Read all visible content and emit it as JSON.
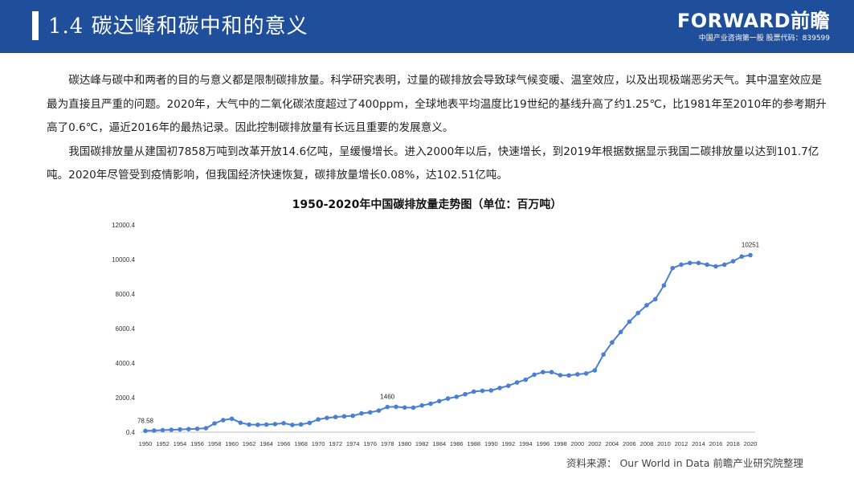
{
  "header": {
    "title": "1.4  碳达峰和碳中和的意义",
    "brand_logo": "FORWARD前瞻",
    "brand_sub": "中国产业咨询第一股  股票代码：839599"
  },
  "paragraphs": [
    "碳达峰与碳中和两者的目的与意义都是限制碳排放量。科学研究表明，过量的碳排放会导致球气候变暖、温室效应，以及出现极端恶劣天气。其中温室效应是最为直接且严重的问题。2020年，大气中的二氧化碳浓度超过了400ppm，全球地表平均温度比19世纪的基线升高了约1.25℃，比1981年至2010年的参考期升高了0.6℃，逼近2016年的最热记录。因此控制碳排放量有长远且重要的发展意义。",
    "我国碳排放量从建国初7858万吨到改革开放14.6亿吨，呈缓慢增长。进入2000年以后，快速增长，到2019年根据数据显示我国二碳排放量以达到101.7亿吨。2020年尽管受到疫情影响，但我国经济快速恢复，碳排放量增长0.08%，达102.51亿吨。"
  ],
  "chart_data": {
    "type": "line",
    "title": "1950-2020年中国碳排放量走势图（单位：百万吨）",
    "x": [
      1950,
      1951,
      1952,
      1953,
      1954,
      1955,
      1956,
      1957,
      1958,
      1959,
      1960,
      1961,
      1962,
      1963,
      1964,
      1965,
      1966,
      1967,
      1968,
      1969,
      1970,
      1971,
      1972,
      1973,
      1974,
      1975,
      1976,
      1977,
      1978,
      1979,
      1980,
      1981,
      1982,
      1983,
      1984,
      1985,
      1986,
      1987,
      1988,
      1989,
      1990,
      1991,
      1992,
      1993,
      1994,
      1995,
      1996,
      1997,
      1998,
      1999,
      2000,
      2001,
      2002,
      2003,
      2004,
      2005,
      2006,
      2007,
      2008,
      2009,
      2010,
      2011,
      2012,
      2013,
      2014,
      2015,
      2016,
      2017,
      2018,
      2019,
      2020
    ],
    "values": [
      78.58,
      95,
      120,
      140,
      160,
      180,
      200,
      230,
      510,
      700,
      780,
      550,
      440,
      430,
      440,
      470,
      520,
      420,
      450,
      540,
      740,
      830,
      880,
      920,
      950,
      1090,
      1150,
      1250,
      1460,
      1470,
      1430,
      1420,
      1550,
      1650,
      1800,
      1950,
      2050,
      2200,
      2350,
      2400,
      2420,
      2560,
      2690,
      2880,
      3040,
      3330,
      3480,
      3480,
      3300,
      3290,
      3350,
      3400,
      3580,
      4500,
      5200,
      5800,
      6400,
      6900,
      7350,
      7700,
      8500,
      9500,
      9700,
      9800,
      9800,
      9700,
      9600,
      9700,
      9900,
      10170,
      10251
    ],
    "xticks": [
      1950,
      1952,
      1954,
      1956,
      1958,
      1960,
      1962,
      1964,
      1966,
      1968,
      1970,
      1972,
      1974,
      1976,
      1978,
      1980,
      1982,
      1984,
      1986,
      1988,
      1990,
      1992,
      1994,
      1996,
      1998,
      2000,
      2002,
      2004,
      2006,
      2008,
      2010,
      2012,
      2014,
      2016,
      2018,
      2020
    ],
    "yticks": [
      "0.4",
      "2000.4",
      "4000.4",
      "6000.4",
      "8000.4",
      "10000.4",
      "12000.4"
    ],
    "ylim": [
      0.4,
      12000.4
    ],
    "annotations": [
      {
        "year": 1950,
        "label": "78.58"
      },
      {
        "year": 1978,
        "label": "1460"
      },
      {
        "year": 2020,
        "label": "10251"
      }
    ],
    "color": "#4a7fd4"
  },
  "source": "资料来源： Our World in Data 前瞻产业研究院整理"
}
